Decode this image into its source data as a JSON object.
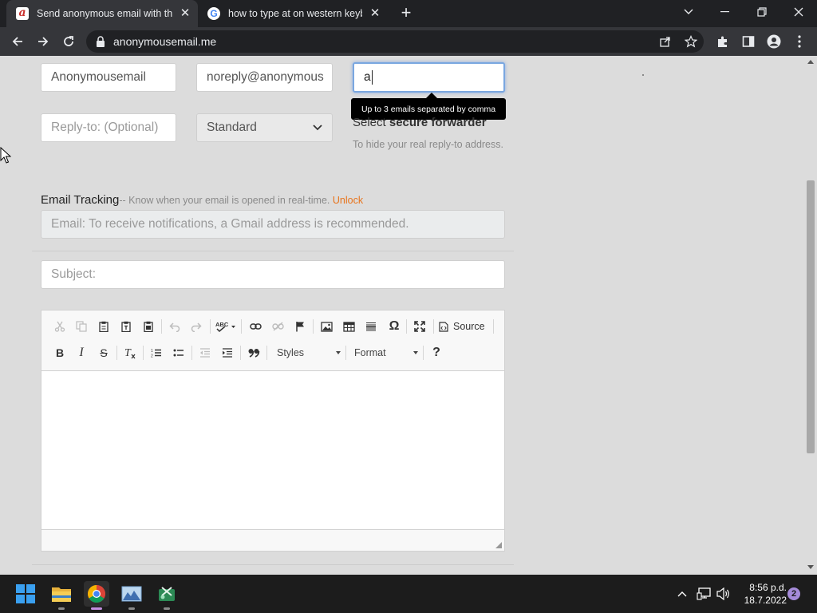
{
  "browser": {
    "tabs": [
      {
        "title": "Send anonymous email with the",
        "favicon": "anonymousemail-favicon"
      },
      {
        "title": "how to type at on western keybo",
        "favicon": "google-favicon"
      }
    ],
    "url": "anonymousemail.me"
  },
  "form": {
    "from_name": "Anonymousemail",
    "from_email": "noreply@anonymous",
    "to_value": "a",
    "to_tooltip": "Up to 3 emails separated by comma",
    "reply_to_placeholder": "Reply-to: (Optional)",
    "forwarder_select": "Standard",
    "forwarder_heading_prefix": "Select ",
    "forwarder_heading_bold": "secure forwarder",
    "forwarder_note": "To hide your real reply-to address.",
    "tracking_label": "Email Tracking",
    "tracking_sub": "-- Know when your email is opened in real-time. ",
    "tracking_unlock": "Unlock",
    "tracking_placeholder": "Email: To receive notifications, a Gmail address is recommended.",
    "subject_placeholder": "Subject:"
  },
  "editor": {
    "source_label": "Source",
    "styles_label": "Styles",
    "format_label": "Format",
    "help_label": "?"
  },
  "taskbar": {
    "time": "8:56 p.d.",
    "date": "18.7.2022",
    "notifications": "2"
  },
  "colors": {
    "unlock": "#e8741c",
    "tab_strip": "#202124",
    "toolbar": "#35363a",
    "page_bg": "#dcdcdc",
    "focus_ring": "#7aa7e0"
  }
}
